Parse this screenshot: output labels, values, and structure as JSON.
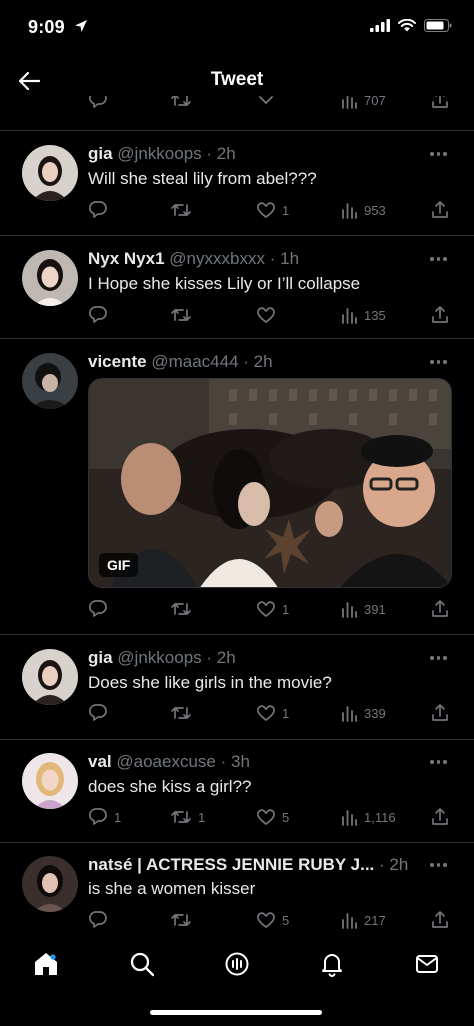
{
  "status_bar": {
    "time": "9:09"
  },
  "nav": {
    "title": "Tweet"
  },
  "partial_top": {
    "views": "707"
  },
  "tweets": [
    {
      "name": "gia",
      "handle": "@jnkkoops",
      "time": "2h",
      "text": "Will she steal lily from abel???",
      "replies": "",
      "retweets": "",
      "likes": "1",
      "views": "953"
    },
    {
      "name": "Nyx Nyx1",
      "handle": "@nyxxxbxxx",
      "time": "1h",
      "text": "I Hope she kisses Lily or I’ll collapse",
      "replies": "",
      "retweets": "",
      "likes": "",
      "views": "135"
    },
    {
      "name": "vicente",
      "handle": "@maac444",
      "time": "2h",
      "text": "",
      "replies": "",
      "retweets": "",
      "likes": "1",
      "views": "391",
      "media_badge": "GIF"
    },
    {
      "name": "gia",
      "handle": "@jnkkoops",
      "time": "2h",
      "text": "Does she like girls in the movie?",
      "replies": "",
      "retweets": "",
      "likes": "1",
      "views": "339"
    },
    {
      "name": "val",
      "handle": "@aoaexcuse",
      "time": "3h",
      "text": "does she kiss a girl??",
      "replies": "1",
      "retweets": "1",
      "likes": "5",
      "views": "1,116"
    },
    {
      "name": "natsé | ACTRESS JENNIE RUBY J...",
      "handle": "",
      "time": "2h",
      "text": "is she a women kisser",
      "replies": "",
      "retweets": "",
      "likes": "5",
      "views": "217"
    }
  ],
  "tabbar": {
    "icons": [
      "home-icon",
      "search-icon",
      "spaces-icon",
      "notifications-icon",
      "messages-icon"
    ]
  },
  "colors": {
    "background": "#000000",
    "text": "#e7e9ea",
    "muted": "#71767b",
    "divider": "#2f3336"
  }
}
